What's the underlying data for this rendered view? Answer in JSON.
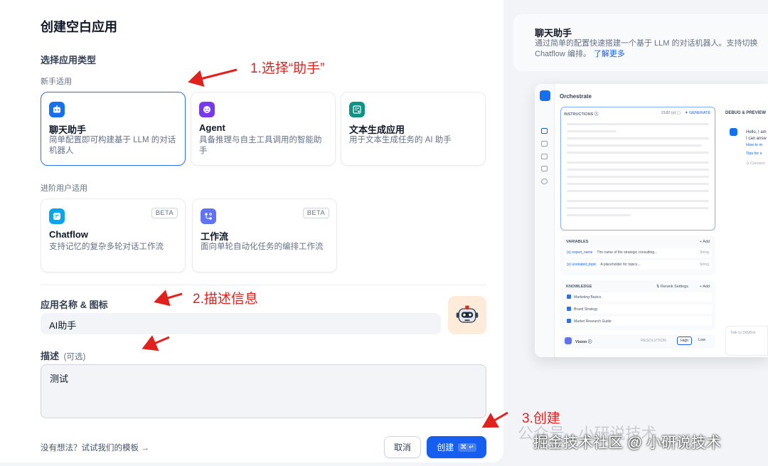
{
  "page_title": "创建空白应用",
  "app_type_section": "选择应用类型",
  "beginner_group": "新手适用",
  "advanced_group": "进阶用户适用",
  "cards": {
    "chatbot": {
      "name": "聊天助手",
      "desc": "简单配置即可构建基于 LLM 的对话机器人"
    },
    "agent": {
      "name": "Agent",
      "desc": "具备推理与自主工具调用的智能助手"
    },
    "textgen": {
      "name": "文本生成应用",
      "desc": "用于文本生成任务的 AI 助手"
    },
    "chatflow": {
      "name": "Chatflow",
      "desc": "支持记忆的复杂多轮对话工作流",
      "badge": "BETA"
    },
    "workflow": {
      "name": "工作流",
      "desc": "面向单轮自动化任务的编排工作流",
      "badge": "BETA"
    }
  },
  "name_section": "应用名称 & 图标",
  "name_value": "AI助手",
  "desc_section": "描述",
  "desc_optional": "(可选)",
  "desc_value": "测试",
  "template_link": "没有想法？试试我们的模板 →",
  "buttons": {
    "cancel": "取消",
    "create": "创建",
    "create_kbd": "⌘ ↵"
  },
  "annotations": {
    "a1": "1.选择“助手”",
    "a2": "2.描述信息",
    "a3": "3.创建"
  },
  "preview_info": {
    "title": "聊天助手",
    "desc_line1": "通过简单的配置快速搭建一个基于 LLM 的对话机器人。支持切换",
    "desc_line2": "Chatflow 编排。",
    "learn_more": "了解更多"
  },
  "preview": {
    "orchestrate": "Orchestrate",
    "instructions": "INSTRUCTIONS ⓘ",
    "instr_meta": "2182  {x}  ▢",
    "generate": "✦ GENERATE",
    "variables": "VARIABLES",
    "add": "+ Add",
    "var_rows": [
      {
        "key": "{x} expert_name",
        "desc": "The name of the strategic consulting...",
        "type": "String"
      },
      {
        "key": "{x} unrelated_topic",
        "desc": "A placeholder for topics...",
        "type": "String"
      }
    ],
    "knowledge": "KNOWLEDGE",
    "rerank": "⇅ Rerank Settings",
    "knowledge_rows": [
      "Marketing Basics",
      "Brand Strategy",
      "Market Research Guide"
    ],
    "vision": "Vision ⓘ",
    "resolution": "RESOLUTION",
    "high": "High",
    "low": "Low",
    "debug": "DEBUG & PREVIEW",
    "chat1": "Hello, I am",
    "chat2": "I can answ",
    "link1": "How to m",
    "link2": "Tips for s",
    "connect": "⊙ Connect",
    "ask": "Talk to DifyBot"
  },
  "watermark_faint": "公众号 · 小研说技术",
  "watermark": "掘金技术社区 @ 小研说技术"
}
